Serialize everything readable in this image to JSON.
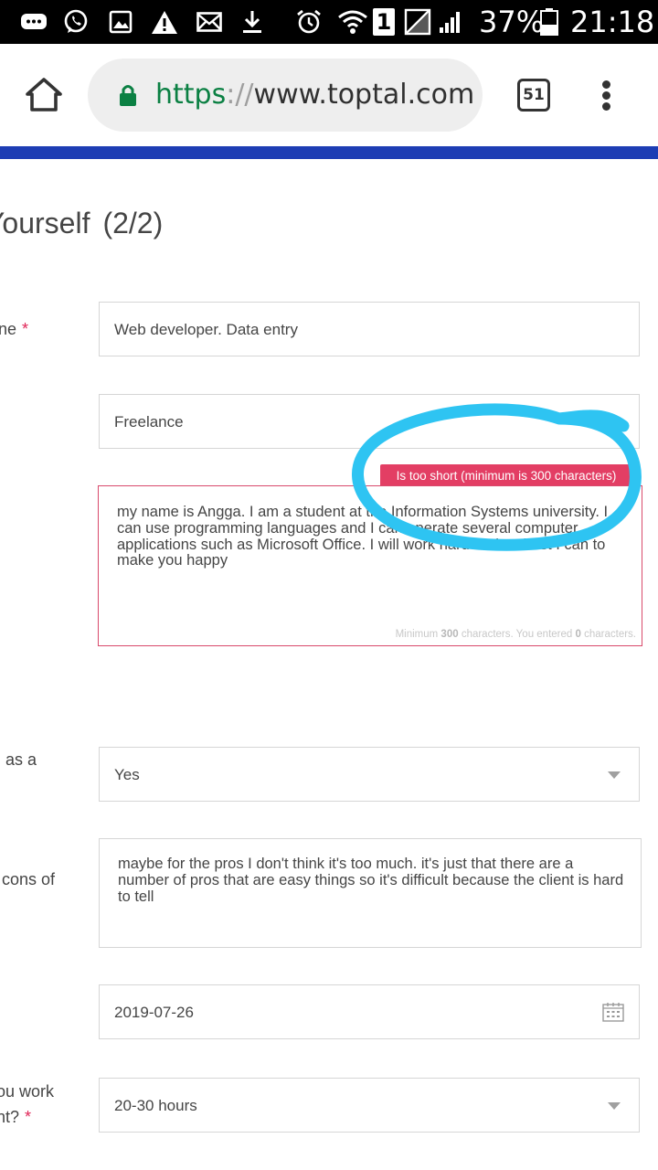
{
  "status_bar": {
    "battery_percent": "37%",
    "time": "21:18",
    "sim_slot": "1",
    "icons": [
      "chat-bubble-icon",
      "whatsapp-icon",
      "image-icon",
      "warning-icon",
      "mail-icon",
      "download-icon",
      "alarm-icon",
      "wifi-icon",
      "sim-icon",
      "signal-empty-icon",
      "signal-icon",
      "battery-icon"
    ]
  },
  "browser": {
    "url_scheme": "https",
    "url_separator": "://",
    "url_host": "www.toptal.com",
    "tab_count": "51",
    "secure": true
  },
  "colors": {
    "band": "#1d3db4",
    "error": "#e33e64",
    "required": "#e02658",
    "annotation": "#2ec4f2"
  },
  "form": {
    "title": "ourself",
    "title_partial_letter": "Y",
    "step": "(2/2)",
    "fields": {
      "job_title": {
        "label": "ne",
        "required": true,
        "value": "Web developer.  Data entry"
      },
      "employment": {
        "value": "Freelance"
      },
      "bio": {
        "value": "my name is Angga. I am a student at the Information Systems university. I can use programming languages and I can operate several computer applications such as Microsoft Office. I will work hard and as best I can to make you happy",
        "error": "Is too short (minimum is 300 characters)",
        "counter_prefix": "Minimum",
        "counter_min": "300",
        "counter_mid": "characters. You entered",
        "counter_entered": "0",
        "counter_suffix": "characters."
      },
      "work_as": {
        "label": "as a",
        "value": "Yes"
      },
      "pros_cons": {
        "label": "cons of",
        "value": "maybe for the pros I don't think it's too much. it's just that there are a number of pros that are easy things so it's difficult because the client is hard to tell"
      },
      "start_date": {
        "value": "2019-07-26"
      },
      "hours": {
        "label_line1": "ou work",
        "label_line2": "nt?",
        "required": true,
        "value": "20-30 hours"
      }
    }
  }
}
